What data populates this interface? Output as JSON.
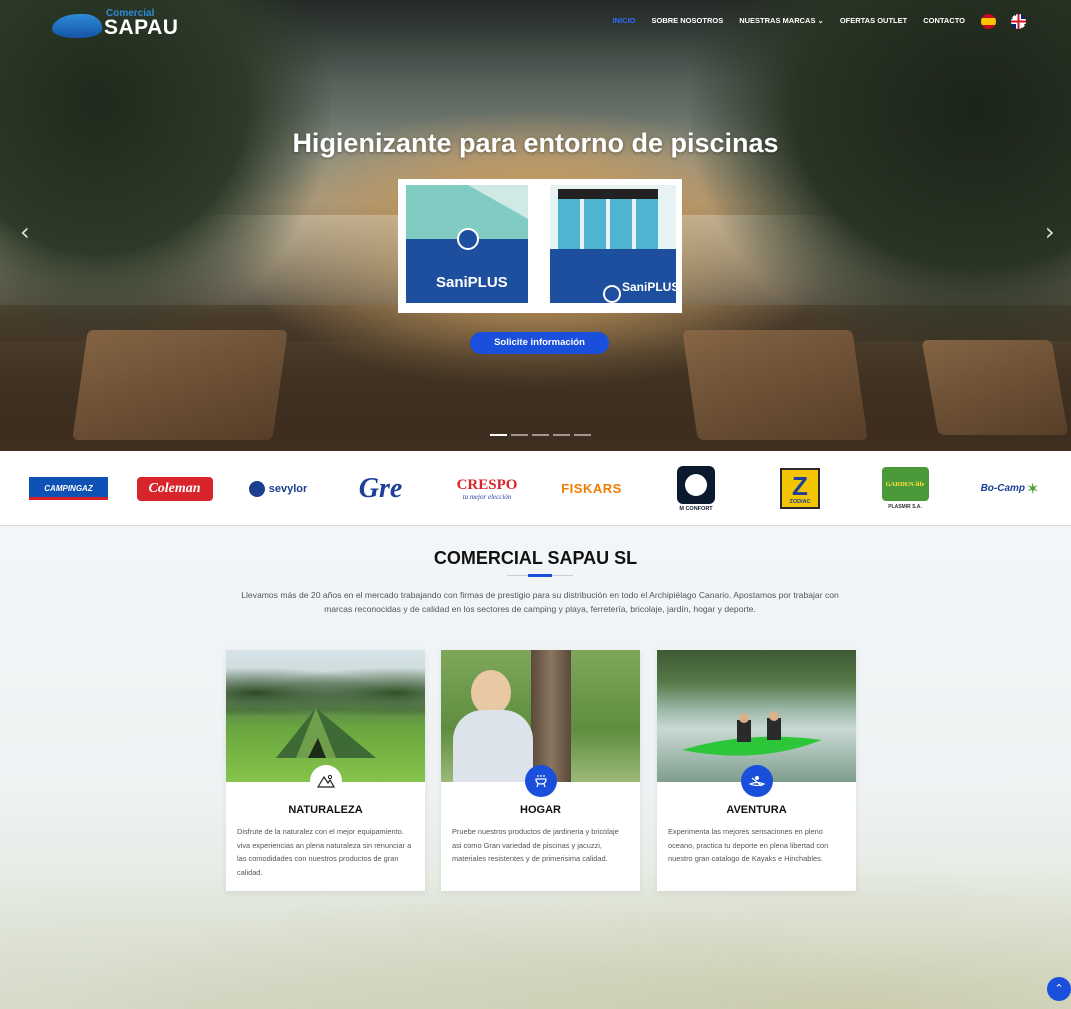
{
  "logo": {
    "small": "Comercial",
    "big": "SAPAU"
  },
  "nav": {
    "items": [
      {
        "label": "INICIO"
      },
      {
        "label": "SOBRE NOSOTROS"
      },
      {
        "label": "NUESTRAS MARCAS ⌄"
      },
      {
        "label": "OFERTAS OUTLET"
      },
      {
        "label": "CONTACTO"
      }
    ],
    "active_color": "#2f6bff"
  },
  "hero": {
    "title": "Higienizante para entorno de piscinas",
    "product_text": "SaniPLUS",
    "cta": "Solicite información",
    "prev": "‹",
    "next": "›",
    "slides": 5,
    "active_slide": 1
  },
  "brands": [
    {
      "name": "CAMPINGAZ"
    },
    {
      "name": "Coleman"
    },
    {
      "name": "sevylor"
    },
    {
      "name": "Gre"
    },
    {
      "name": "CRESPO",
      "tagline": "tu mejor elección"
    },
    {
      "name": "FISKARS"
    },
    {
      "name": "M CONFORT"
    },
    {
      "name": "ZODIAC"
    },
    {
      "name": "GARDEN-life",
      "sub": "PLASMIR S.A."
    },
    {
      "name": "Bo-Camp"
    }
  ],
  "about": {
    "title": "COMERCIAL SAPAU SL",
    "intro": "Llevamos más de 20 años en el mercado trabajando con firmas de prestigio para su distribución en todo el Archipiélago Canario. Apostamos por trabajar con marcas reconocidas y de calidad en los sectores de camping y playa, ferretería, bricolaje, jardín, hogar y deporte."
  },
  "cards": [
    {
      "title": "NATURALEZA",
      "icon": "mountain-icon",
      "text": "Disfrute de la naturalez con el mejor equipamiento. viva experiencias an plena naturaleza sin renunciar a las comodidades con nuestros productos de gran calidad."
    },
    {
      "title": "HOGAR",
      "icon": "grill-icon",
      "text": "Pruebe nuestros productos de jardineria y bricolaje asi como Gran variedad de piscinas y jacuzzi, materiales resistentes y de primerisima calidad."
    },
    {
      "title": "AVENTURA",
      "icon": "kayak-icon",
      "text": "Experimenta las mejores sensaciones en pleno oceano, practica tu deporte en plena libertad con nuestro gran catalogo de Kayaks e Hinchables."
    }
  ],
  "colors": {
    "primary": "#1a4fdc",
    "brand_blue": "#2f8bd8"
  },
  "scroll_top": "⌃"
}
